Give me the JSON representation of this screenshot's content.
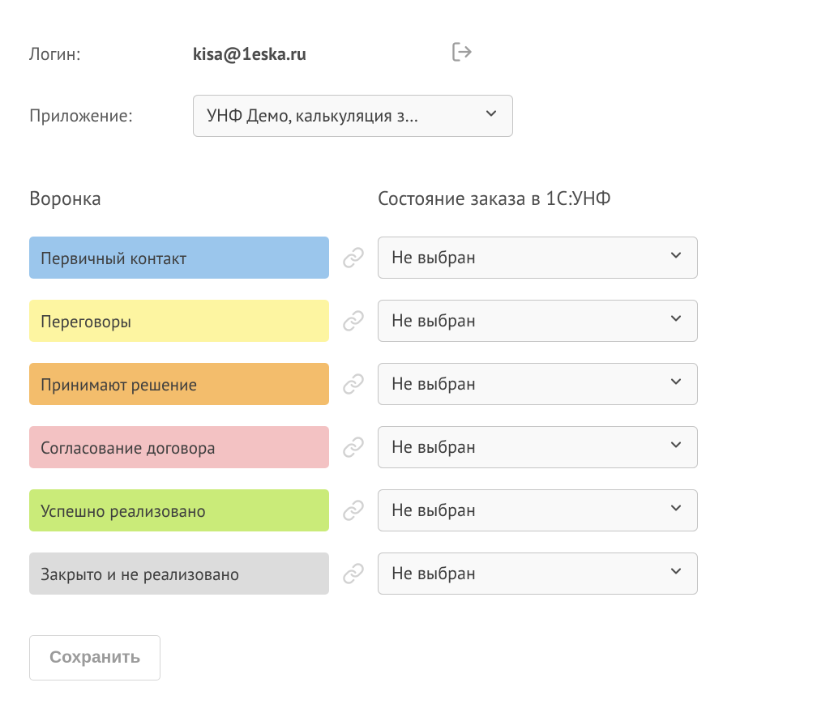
{
  "login": {
    "label": "Логин:",
    "value": "kisa@1eska.ru"
  },
  "app": {
    "label": "Приложение:",
    "selected": "УНФ Демо, калькуляция з…"
  },
  "columns": {
    "funnel": "Воронка",
    "state": "Состояние заказа в 1С:УНФ"
  },
  "mappings": [
    {
      "stage": "Первичный контакт",
      "color": "#9bc6ec",
      "state": "Не выбран"
    },
    {
      "stage": "Переговоры",
      "color": "#fdf5a1",
      "state": "Не выбран"
    },
    {
      "stage": "Принимают решение",
      "color": "#f3bd6c",
      "state": "Не выбран"
    },
    {
      "stage": "Согласование договора",
      "color": "#f3c2c3",
      "state": "Не выбран"
    },
    {
      "stage": "Успешно реализовано",
      "color": "#caeb79",
      "state": "Не выбран"
    },
    {
      "stage": "Закрыто и не реализовано",
      "color": "#dcdcdc",
      "state": "Не выбран"
    }
  ],
  "actions": {
    "save": "Сохранить"
  }
}
